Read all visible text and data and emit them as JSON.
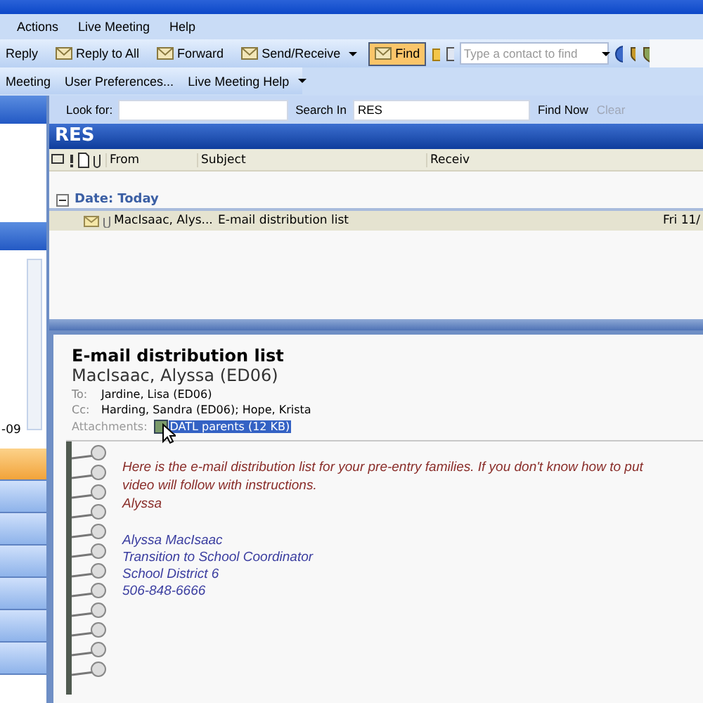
{
  "menu": [
    "Actions",
    "Live Meeting",
    "Help"
  ],
  "toolbar": [
    {
      "label": "Reply",
      "pressed": false,
      "dropdown": false
    },
    {
      "label": "Reply to All",
      "pressed": false,
      "dropdown": false
    },
    {
      "label": "Forward",
      "pressed": false,
      "dropdown": false
    },
    {
      "label": "Send/Receive",
      "pressed": false,
      "dropdown": true
    },
    {
      "label": "Find",
      "pressed": true,
      "dropdown": false
    }
  ],
  "contact_search": {
    "placeholder": "Type a contact to find"
  },
  "toolbar2": [
    {
      "label": "Meeting",
      "dropdown": false
    },
    {
      "label": "User Preferences...",
      "dropdown": false
    },
    {
      "label": "Live Meeting Help",
      "dropdown": true
    }
  ],
  "find_bar": {
    "look_for_label": "Look for:",
    "search_in_label": "Search In",
    "search_in": "RES",
    "find_now": "Find Now",
    "clear": "Clear"
  },
  "nav": {
    "calendar_text": "-09",
    "buttons": [
      {
        "selected": true
      },
      {
        "selected": false
      },
      {
        "selected": false
      },
      {
        "selected": false
      },
      {
        "selected": false
      },
      {
        "selected": false
      },
      {
        "selected": false
      }
    ]
  },
  "folder": {
    "title": "RES",
    "columns": [
      "From",
      "Subject",
      "Receiv"
    ],
    "groups": [
      {
        "label": "Date: Today",
        "expanded": true,
        "rows": [
          {
            "from": "MacIsaac, Alys...",
            "subject": "E-mail distribution list",
            "received": "Fri 11/",
            "attachment": true,
            "selected": true
          }
        ]
      }
    ]
  },
  "message": {
    "subject": "E-mail distribution list",
    "sender": "MacIsaac, Alyssa (ED06)",
    "to_label": "To:",
    "to": "Jardine, Lisa (ED06)",
    "cc_label": "Cc:",
    "cc": "Harding, Sandra (ED06); Hope, Krista",
    "attachments_label": "Attachments:",
    "attachment": "DATL parents (12 KB)",
    "body": [
      {
        "kind": "note",
        "text": "Here is the e-mail distribution list for your pre-entry families.  If you don't know how to put"
      },
      {
        "kind": "note",
        "text": "video will follow with instructions."
      },
      {
        "kind": "note",
        "text": "Alyssa"
      },
      {
        "kind": "gap"
      },
      {
        "kind": "signature",
        "text": "Alyssa MacIsaac"
      },
      {
        "kind": "signature",
        "text": "Transition to School Coordinator"
      },
      {
        "kind": "signature",
        "text": "School District 6"
      },
      {
        "kind": "signature",
        "text": "506-848-6666"
      }
    ]
  }
}
